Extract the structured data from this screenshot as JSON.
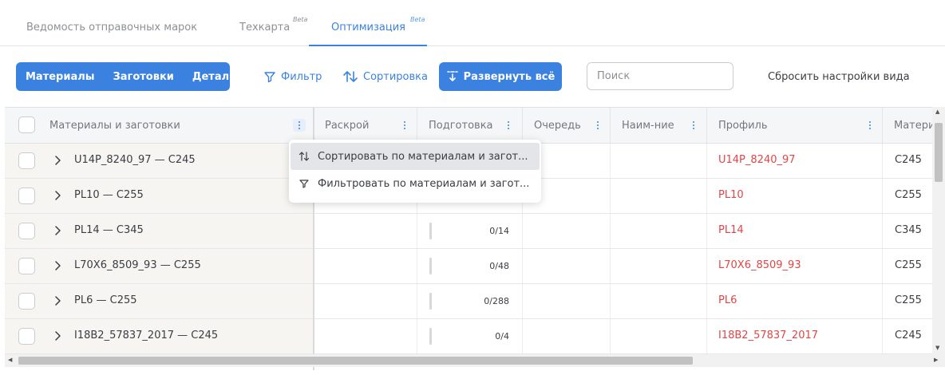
{
  "tabs": [
    {
      "label": "Ведомость отправочных марок",
      "beta": ""
    },
    {
      "label": "Техкарта",
      "beta": "Beta"
    },
    {
      "label": "Оптимизация",
      "beta": "Beta"
    }
  ],
  "toolbar": {
    "segments": [
      "Материалы",
      "Заготовки",
      "Детали"
    ],
    "filter_label": "Фильтр",
    "sort_label": "Сортировка",
    "expand_label": "Развернуть всё",
    "search_placeholder": "Поиск",
    "reset_label": "Сбросить настройки вида"
  },
  "columns": [
    "Материалы и заготовки",
    "Раскрой",
    "Подготовка",
    "Очередь",
    "Наим-ние",
    "Профиль",
    "Матери"
  ],
  "rows": [
    {
      "name": "U14P_8240_97 — C245",
      "prep": "",
      "profile": "U14P_8240_97",
      "material": "C245"
    },
    {
      "name": "PL10 — C255",
      "prep": "",
      "profile": "PL10",
      "material": "C255"
    },
    {
      "name": "PL14 — C345",
      "prep": "0/14",
      "profile": "PL14",
      "material": "C345"
    },
    {
      "name": "L70X6_8509_93 — C255",
      "prep": "0/48",
      "profile": "L70X6_8509_93",
      "material": "C255"
    },
    {
      "name": "PL6 — C255",
      "prep": "0/288",
      "profile": "PL6",
      "material": "C255"
    },
    {
      "name": "I18B2_57837_2017 — C245",
      "prep": "0/4",
      "profile": "I18B2_57837_2017",
      "material": "C245"
    }
  ],
  "column_menu": {
    "sort_label": "Сортировать по материалам и загот...",
    "filter_label": "Фильтровать по материалам и загот..."
  },
  "colors": {
    "accent": "#3b82e0",
    "profile_text": "#e04646",
    "frozen_bg": "#f6f5f2"
  }
}
